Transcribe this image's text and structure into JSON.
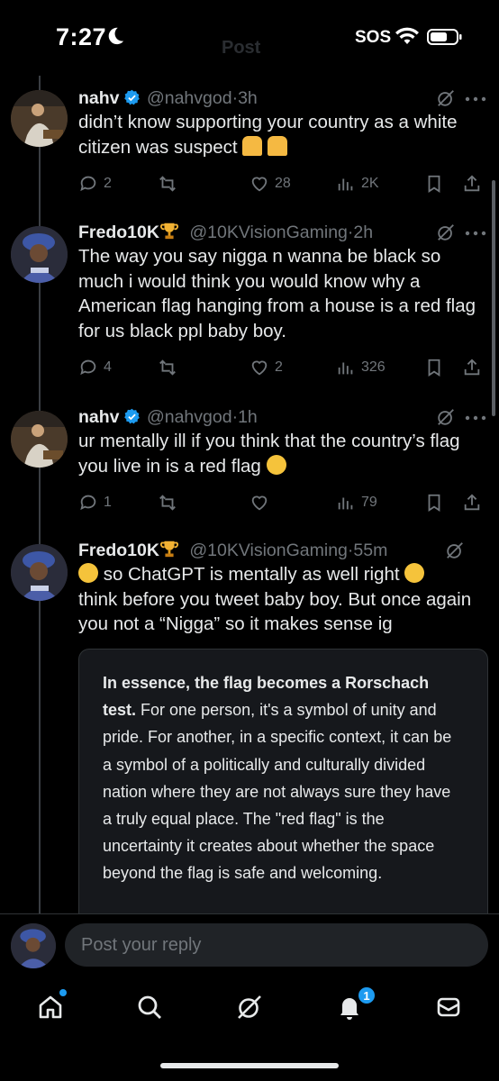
{
  "status_bar": {
    "time": "7:27",
    "sos": "SOS"
  },
  "nav": {
    "title": "Post"
  },
  "tweets": [
    {
      "name": "nahv",
      "handle": "@nahvgod",
      "sep": "·",
      "time": "3h",
      "text": "didn’t know supporting your country as a white citizen was suspect",
      "emojis": [
        "person-shrugging-emoji",
        "person-facepalming-emoji"
      ],
      "replies": "2",
      "reposts": "",
      "likes": "28",
      "views": "2K"
    },
    {
      "name": "Fredo10K",
      "handle": "@10KVisionGaming",
      "sep": "·",
      "time": "2h",
      "text": "The way you say nigga n wanna be black so much i would think you would know why a American flag hanging from a house is a red flag for us black ppl baby boy.",
      "replies": "4",
      "reposts": "",
      "likes": "2",
      "views": "326"
    },
    {
      "name": "nahv",
      "handle": "@nahvgod",
      "sep": "·",
      "time": "1h",
      "text": "ur mentally ill if you think that the country’s flag you live in is a red flag",
      "emojis": [
        "loudly-crying-face-emoji"
      ],
      "replies": "1",
      "reposts": "",
      "likes": "",
      "views": "79"
    },
    {
      "name": "Fredo10K",
      "handle": "@10KVisionGaming",
      "sep": "·",
      "time": "55m",
      "text_line1": "so ChatGPT is mentally as well right",
      "text_rest": "think before you tweet baby boy. But once again you not a “Nigga” so it makes sense ig"
    }
  ],
  "quote": {
    "bold": "In essence, the flag becomes a Rorschach test.",
    "body": "For one person, it's a symbol of unity and pride. For another, in a specific context, it can be a symbol of a politically and culturally divided nation where they are not always sure they have a truly equal place. The \"red flag\" is the uncertainty it creates about whether the space beyond the flag is safe and welcoming."
  },
  "reply": {
    "placeholder": "Post your reply"
  },
  "tab_bar": {
    "notifications_badge": "1"
  },
  "colors": {
    "accent": "#1d9bf0",
    "muted": "#71767b",
    "background": "#000000"
  }
}
